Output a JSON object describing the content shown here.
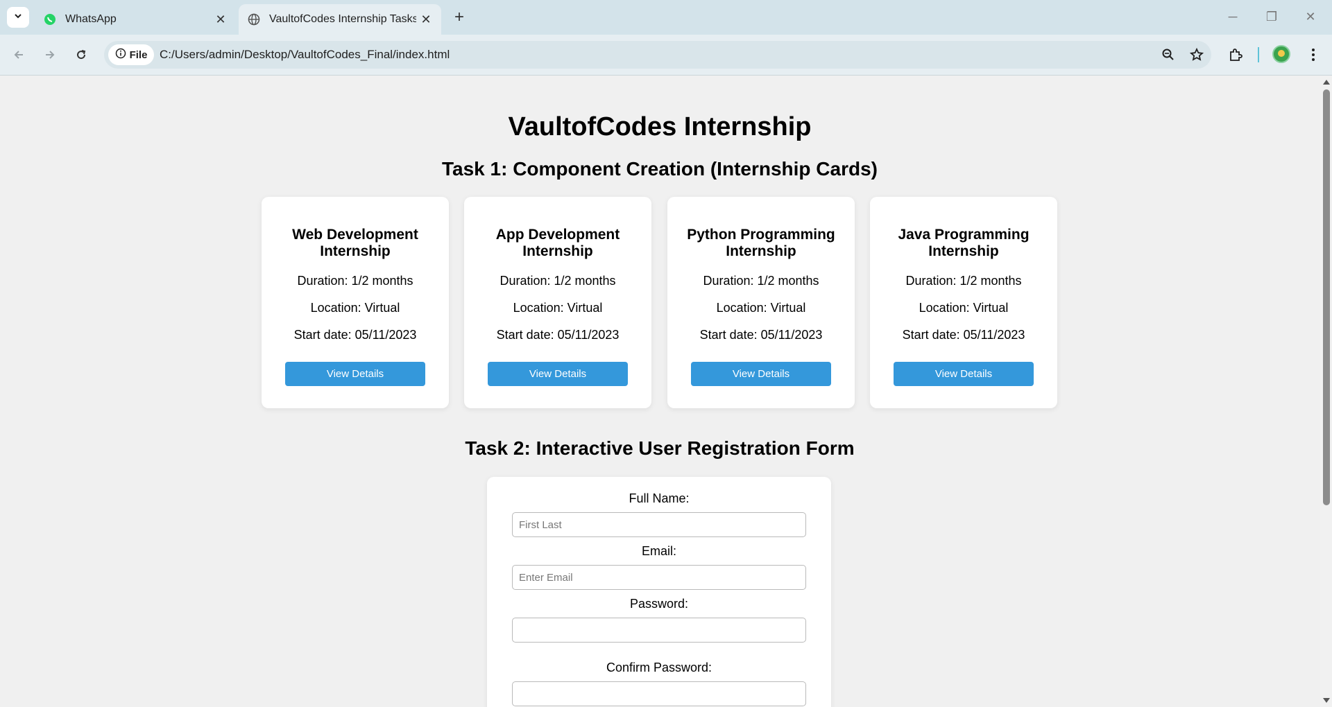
{
  "browser": {
    "tabs": [
      {
        "title": "WhatsApp",
        "active": false,
        "icon": "whatsapp-icon"
      },
      {
        "title": "VaultofCodes Internship Tasks",
        "active": true,
        "icon": "globe-icon"
      }
    ],
    "chip_label": "File",
    "url": "C:/Users/admin/Desktop/VaultofCodes_Final/index.html"
  },
  "page": {
    "title": "VaultofCodes Internship",
    "task1_heading": "Task 1: Component Creation (Internship Cards)",
    "task2_heading": "Task 2: Interactive User Registration Form"
  },
  "cards": [
    {
      "title": "Web Development Internship",
      "duration": "Duration: 1/2 months",
      "location": "Location: Virtual",
      "start": "Start date: 05/11/2023",
      "button": "View Details"
    },
    {
      "title": "App Development Internship",
      "duration": "Duration: 1/2 months",
      "location": "Location: Virtual",
      "start": "Start date: 05/11/2023",
      "button": "View Details"
    },
    {
      "title": "Python Programming Internship",
      "duration": "Duration: 1/2 months",
      "location": "Location: Virtual",
      "start": "Start date: 05/11/2023",
      "button": "View Details"
    },
    {
      "title": "Java Programming Internship",
      "duration": "Duration: 1/2 months",
      "location": "Location: Virtual",
      "start": "Start date: 05/11/2023",
      "button": "View Details"
    }
  ],
  "form": {
    "full_name_label": "Full Name:",
    "full_name_placeholder": "First Last",
    "email_label": "Email:",
    "email_placeholder": "Enter Email",
    "password_label": "Password:",
    "confirm_label": "Confirm Password:"
  },
  "colors": {
    "accent": "#3498db",
    "page_bg": "#f0f0f0",
    "card_bg": "#ffffff"
  }
}
